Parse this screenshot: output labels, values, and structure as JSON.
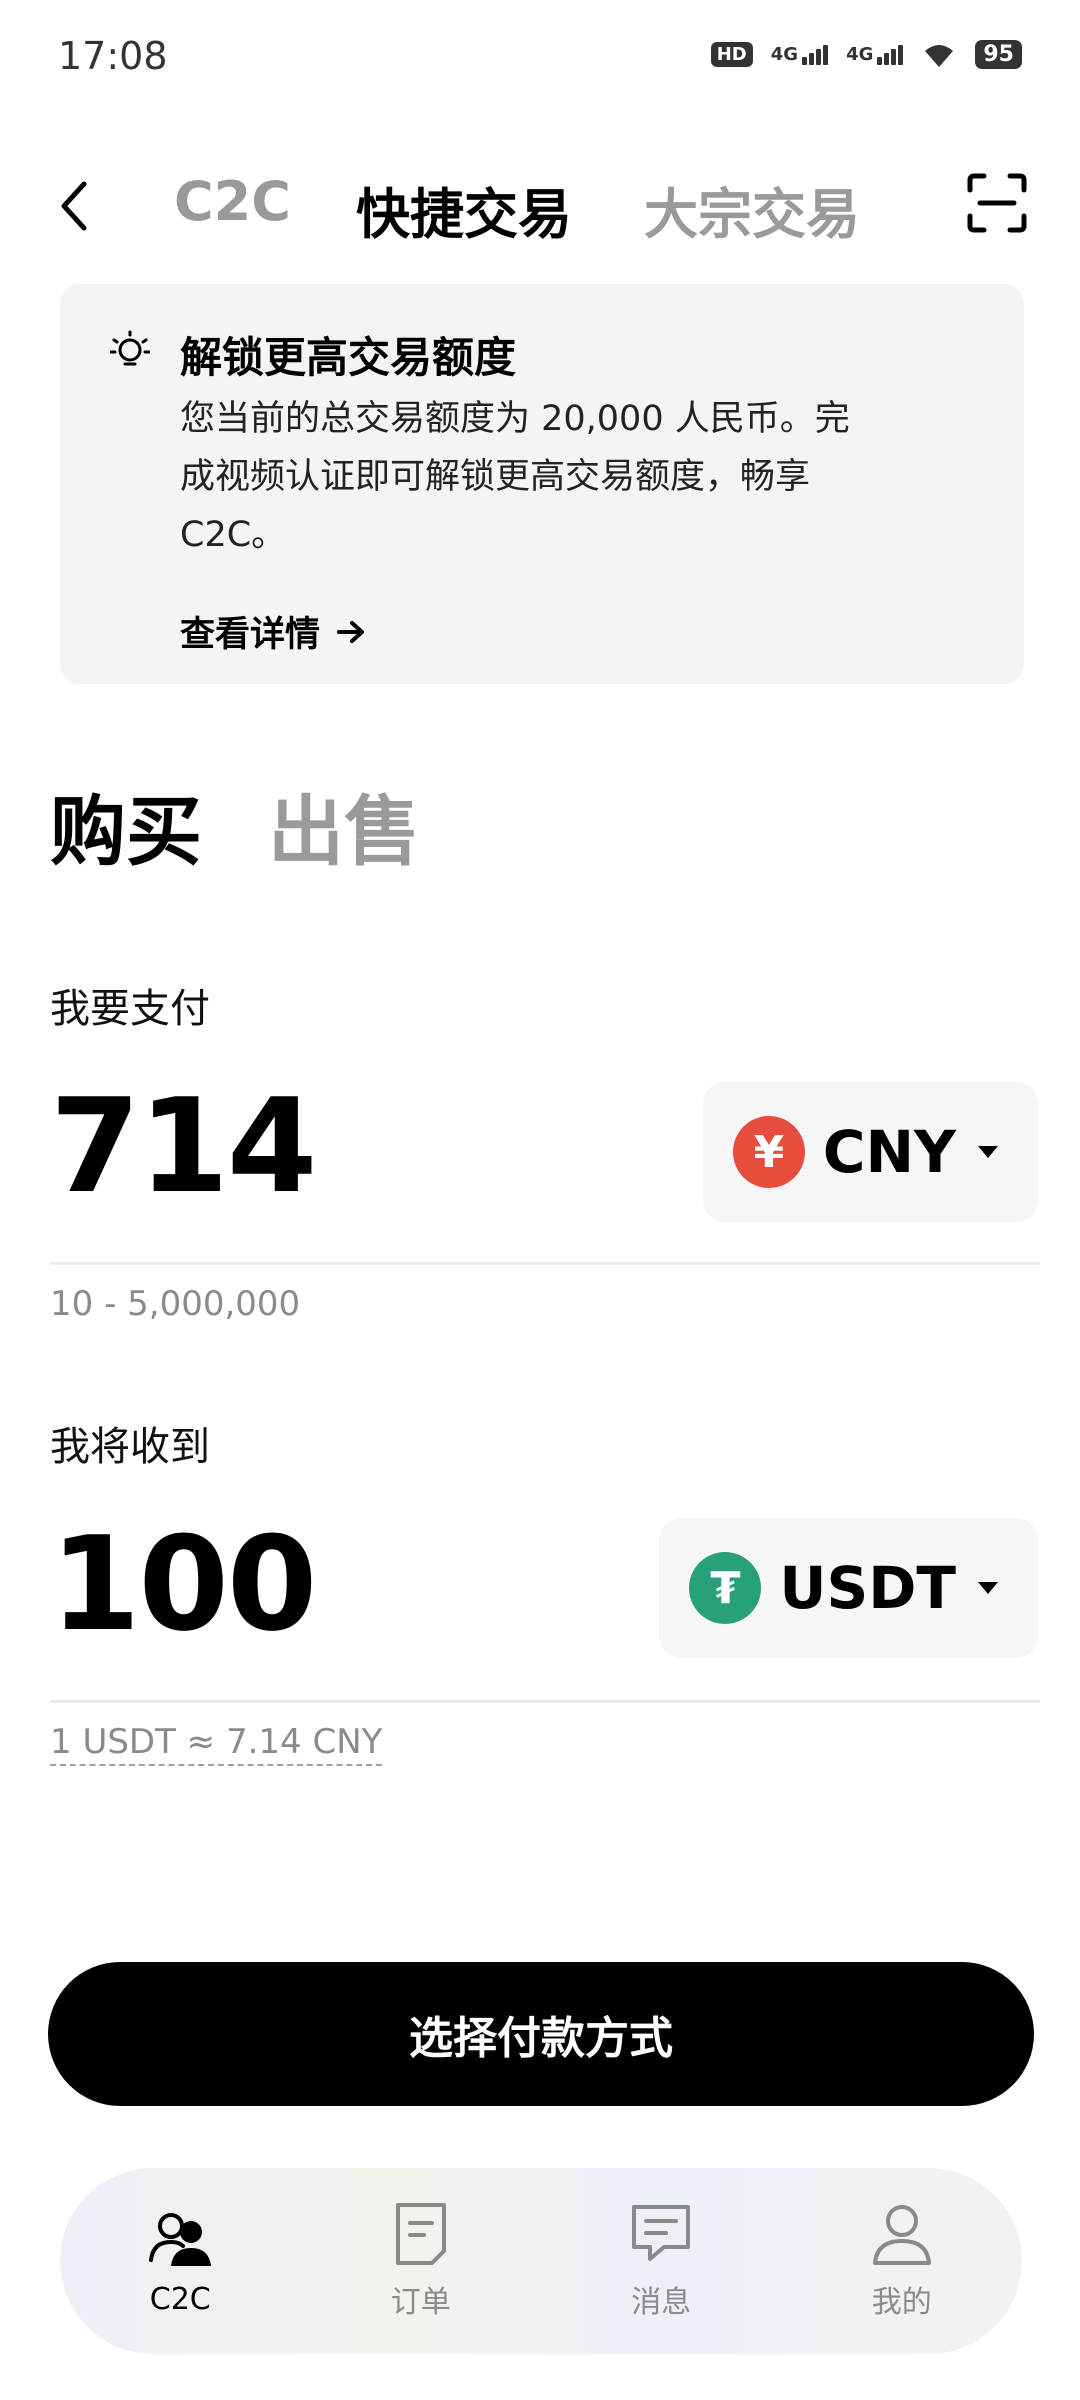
{
  "status_bar": {
    "time": "17:08",
    "hd_label": "HD",
    "network_1": "4G",
    "network_2": "4G",
    "battery": "95"
  },
  "top_nav": {
    "tabs": [
      {
        "label": "C2C",
        "active": false
      },
      {
        "label": "快捷交易",
        "active": true
      },
      {
        "label": "大宗交易",
        "active": false
      }
    ]
  },
  "banner": {
    "title": "解锁更高交易额度",
    "body": "您当前的总交易额度为 20,000 人民币。完成视频认证即可解锁更高交易额度，畅享 C2C。",
    "link": "查看详情"
  },
  "trade_tabs": {
    "buy": "购买",
    "sell": "出售"
  },
  "pay": {
    "label": "我要支付",
    "amount": "714",
    "currency": "CNY",
    "currency_symbol": "¥",
    "range": "10 - 5,000,000"
  },
  "receive": {
    "label": "我将收到",
    "amount": "100",
    "currency": "USDT",
    "currency_symbol": "₮",
    "rate": "1 USDT ≈ 7.14 CNY"
  },
  "cta": {
    "label": "选择付款方式"
  },
  "bottom_nav": {
    "items": [
      {
        "label": "C2C",
        "icon": "users-icon",
        "active": true
      },
      {
        "label": "订单",
        "icon": "order-icon",
        "active": false
      },
      {
        "label": "消息",
        "icon": "message-icon",
        "active": false
      },
      {
        "label": "我的",
        "icon": "profile-icon",
        "active": false
      }
    ]
  },
  "colors": {
    "cny_coin": "#e74c3c",
    "usdt_coin": "#26a17b",
    "accent": "#000000",
    "muted": "#9a9a9a"
  }
}
